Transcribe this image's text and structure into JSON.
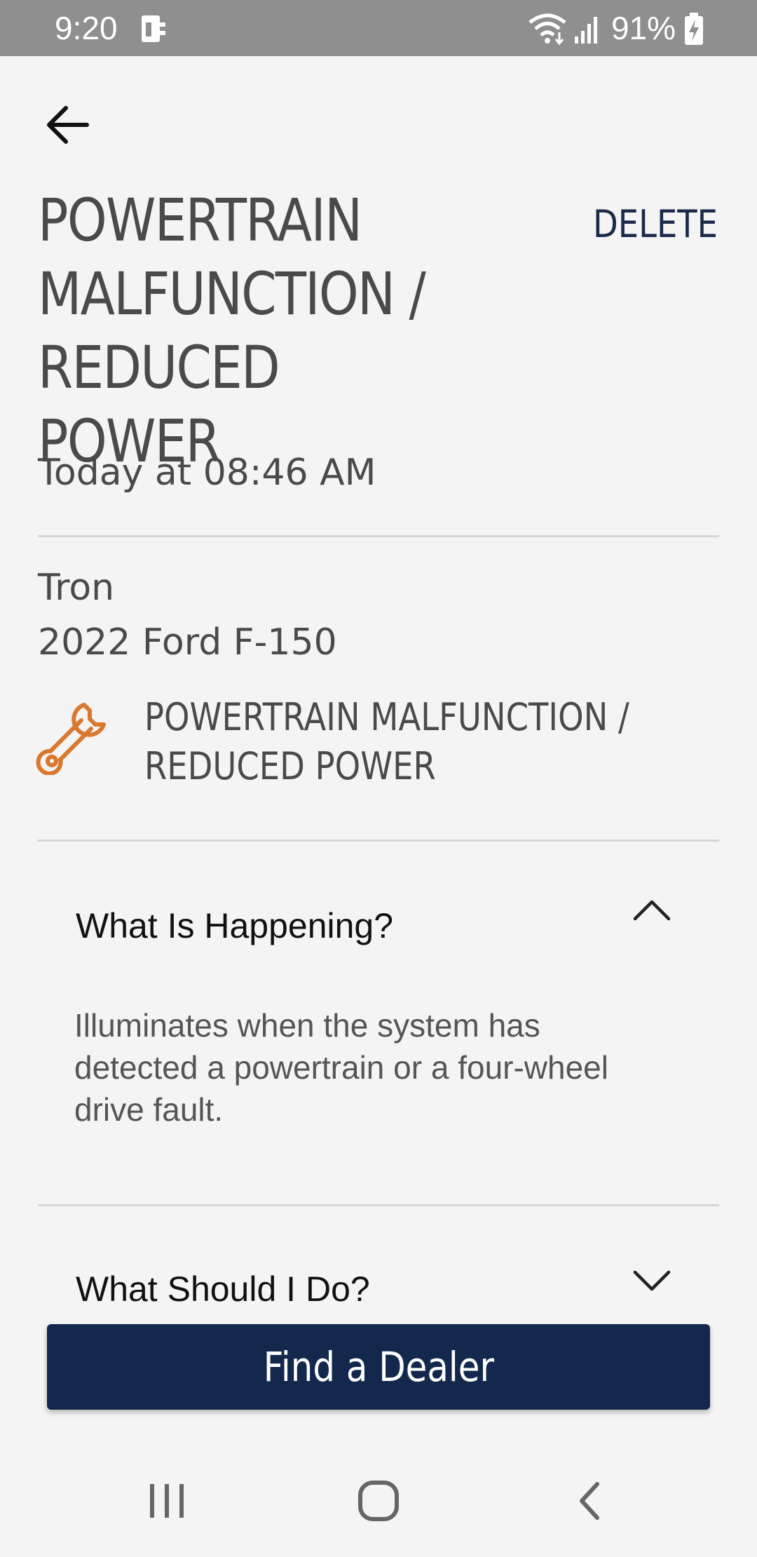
{
  "status_bar": {
    "time": "9:20",
    "battery": "91%",
    "icons": [
      "sim-card-icon",
      "wifi-icon",
      "signal-icon",
      "battery-charging-icon"
    ]
  },
  "header": {
    "back_icon": "arrow-left-icon",
    "title": "POWERTRAIN MALFUNCTION / REDUCED POWER",
    "delete_label": "DELETE"
  },
  "alert": {
    "time": "Today at 08:46 AM",
    "vehicle_name": "Tron",
    "vehicle_model": "2022 Ford F-150",
    "icon": "wrench-icon",
    "label": "POWERTRAIN MALFUNCTION / REDUCED POWER"
  },
  "sections": [
    {
      "title": "What Is Happening?",
      "expanded": true,
      "body": "Illuminates when the system has detected a powertrain or a four-wheel drive fault."
    },
    {
      "title": "What Should I Do?",
      "expanded": false
    }
  ],
  "cta": {
    "label": "Find a Dealer"
  },
  "nav": {
    "recent": "recent-apps-icon",
    "home": "home-icon",
    "back": "back-icon"
  },
  "colors": {
    "primary": "#13284c",
    "accent": "#d9782f",
    "status_bar": "#8f8f8f",
    "background": "#f4f4f4"
  }
}
